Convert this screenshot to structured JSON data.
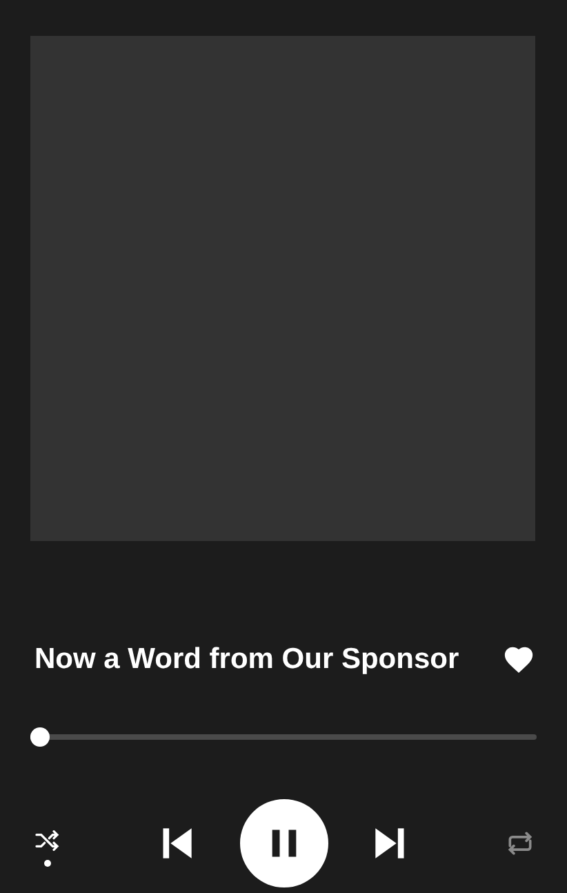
{
  "track": {
    "title": "Now a Word from Our Sponsor",
    "liked": true
  },
  "progress": {
    "level": 0.02
  },
  "controls": {
    "shuffle": true,
    "repeat": false,
    "playing": true
  }
}
